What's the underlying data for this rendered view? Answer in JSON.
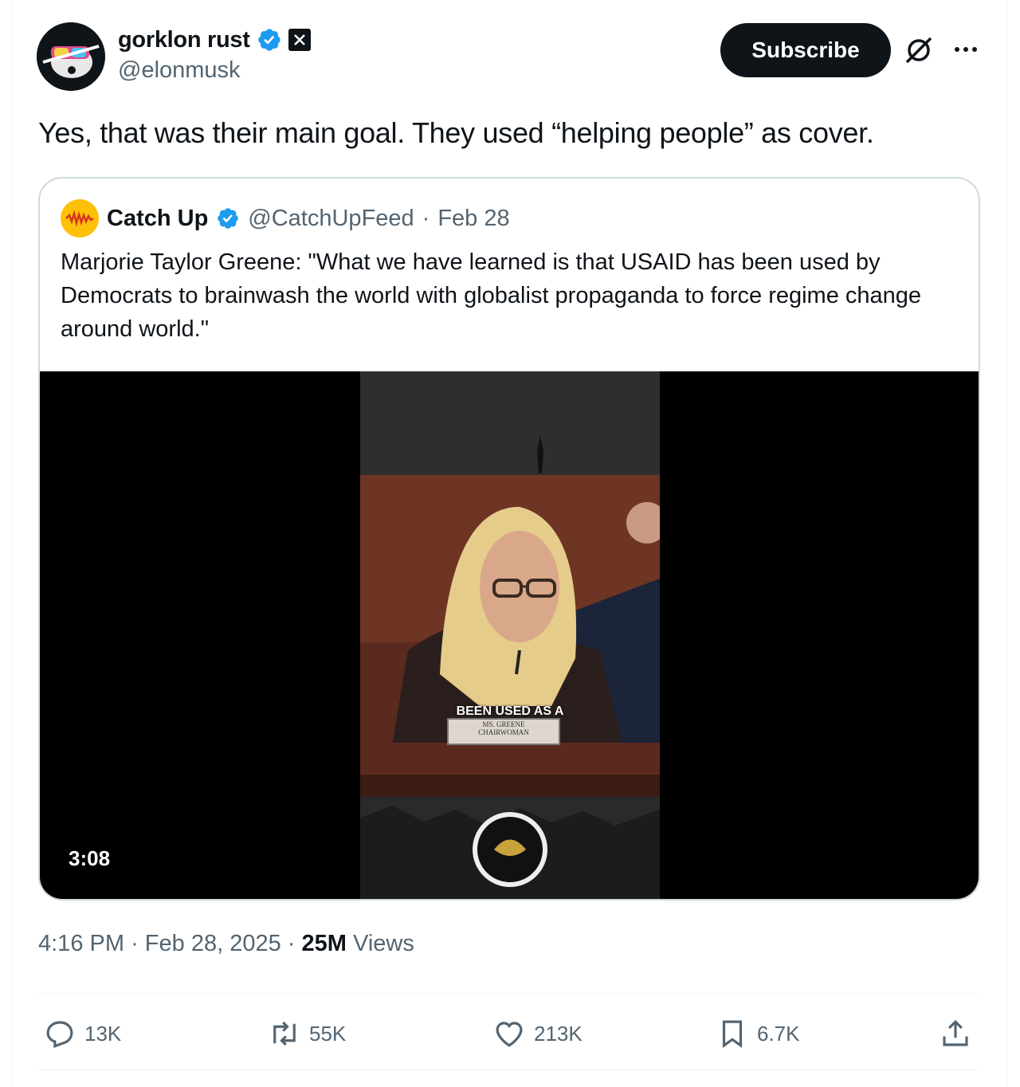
{
  "author": {
    "display_name": "gorklon rust",
    "handle": "@elonmusk",
    "verified_color": "#1d9bf0"
  },
  "header": {
    "subscribe_label": "Subscribe",
    "grok_icon": "grok-icon",
    "more_icon": "more-icon"
  },
  "tweet": {
    "text": "Yes, that was their main goal. They used “helping people” as cover."
  },
  "quote": {
    "display_name": "Catch Up",
    "handle": "@CatchUpFeed",
    "separator": "·",
    "date": "Feb 28",
    "text": "Marjorie Taylor Greene: \"What we have learned is that USAID has been used by Democrats to brainwash the world with globalist propaganda to force regime change around world.\"",
    "video": {
      "duration": "3:08",
      "caption": "BEEN USED AS A",
      "nameplate_line1": "MS. GREENE",
      "nameplate_line2": "CHAIRWOMAN"
    }
  },
  "meta": {
    "time": "4:16 PM",
    "sep1": "·",
    "date": "Feb 28, 2025",
    "sep2": "·",
    "views_count": "25M",
    "views_label": "Views"
  },
  "actions": {
    "replies": "13K",
    "reposts": "55K",
    "likes": "213K",
    "bookmarks": "6.7K"
  }
}
